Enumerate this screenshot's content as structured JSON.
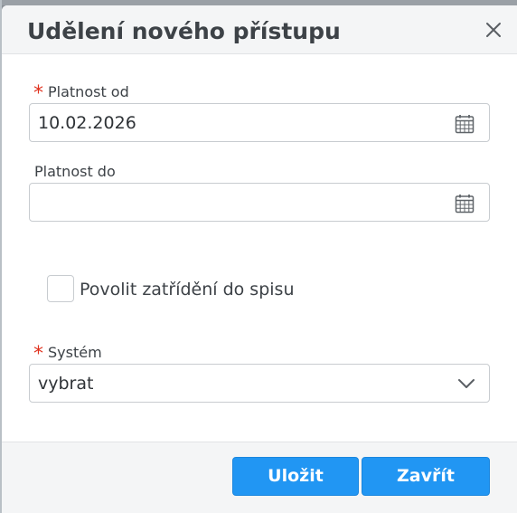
{
  "dialog": {
    "title": "Udělení nového přístupu",
    "close_icon": "close-icon"
  },
  "fields": {
    "valid_from": {
      "required_mark": "*",
      "label": "Platnost od",
      "value": "10.02.2026",
      "icon": "calendar-icon"
    },
    "valid_to": {
      "label": "Platnost do",
      "value": "",
      "icon": "calendar-icon"
    },
    "allow_filing": {
      "label": "Povolit zatřídění do spisu",
      "checked": false
    },
    "system": {
      "required_mark": "*",
      "label": "Systém",
      "selected": "vybrat",
      "icon": "chevron-down-icon"
    }
  },
  "footer": {
    "save_label": "Uložit",
    "close_label": "Zavřít"
  },
  "colors": {
    "primary_button": "#2196f3",
    "required_star": "#e0331f",
    "header_background": "#f4f5f6"
  }
}
